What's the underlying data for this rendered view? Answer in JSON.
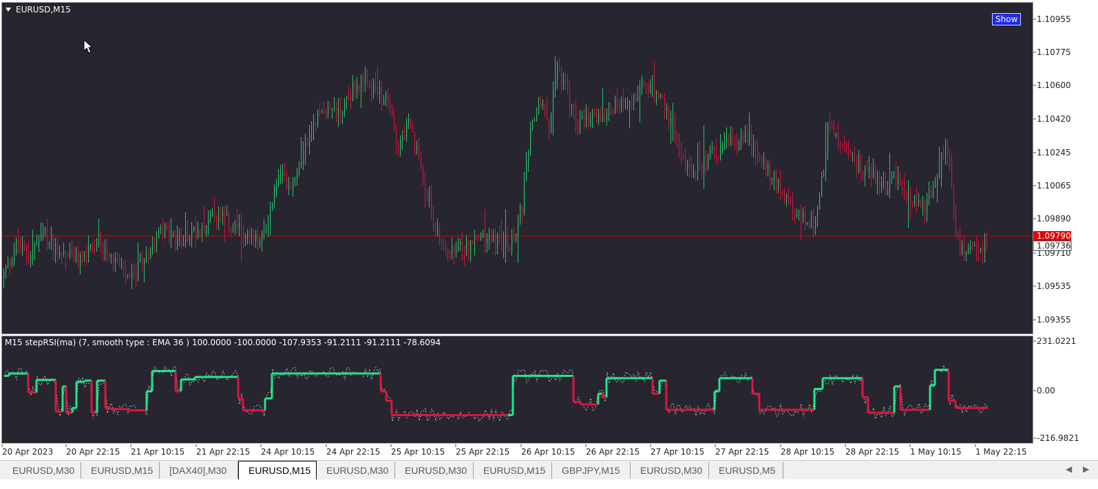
{
  "chart": {
    "symbol_title": "EURUSD,M15",
    "show_button": "Show",
    "price_ticks": [
      "1.10955",
      "1.10775",
      "1.10600",
      "1.10420",
      "1.10245",
      "1.10065",
      "1.09890",
      "1.09710",
      "1.09535",
      "1.09355"
    ],
    "price_line_label": "1.09790",
    "bid_label": "1.09736",
    "time_labels": [
      "20 Apr 2023",
      "20 Apr 22:15",
      "21 Apr 10:15",
      "21 Apr 22:15",
      "24 Apr 10:15",
      "24 Apr 22:15",
      "25 Apr 10:15",
      "25 Apr 22:15",
      "26 Apr 10:15",
      "26 Apr 22:15",
      "27 Apr 10:15",
      "27 Apr 22:15",
      "28 Apr 10:15",
      "28 Apr 22:15",
      "1 May 10:15",
      "1 May 22:15"
    ],
    "colors": {
      "background": "#272530",
      "bull": "#27c46b",
      "bear": "#d0143c",
      "price_line": "#d40000"
    }
  },
  "indicator": {
    "title": "M15 stepRSI(ma)  (7, smooth type : EMA  36 ) 100.0000 -100.0000 -107.9353 -91.2111 -91.2111 -78.6094",
    "ticks": [
      "231.0221",
      "0.00",
      "-216.9821"
    ],
    "colors": {
      "up": "#1ee88a",
      "down": "#e0143c",
      "raw": "#d8d8d8"
    }
  },
  "tabs": [
    {
      "label": "EURUSD,M30",
      "active": false
    },
    {
      "label": "EURUSD,M15",
      "active": false
    },
    {
      "label": "[DAX40],M30",
      "active": false
    },
    {
      "label": "EURUSD,M15",
      "active": true
    },
    {
      "label": "EURUSD,M30",
      "active": false
    },
    {
      "label": "EURUSD,M30",
      "active": false
    },
    {
      "label": "EURUSD,M15",
      "active": false
    },
    {
      "label": "GBPJPY,M15",
      "active": false
    },
    {
      "label": "EURUSD,M30",
      "active": false
    },
    {
      "label": "EURUSD,M5",
      "active": false
    }
  ],
  "chart_data": {
    "type": "candlestick",
    "title": "EURUSD,M15",
    "x_range": [
      "20 Apr 2023",
      "1 May 22:15"
    ],
    "ylim": [
      1.0925,
      1.1108
    ],
    "price_line": 1.0979,
    "bid": 1.09736,
    "close_path": [
      [
        "20 Apr 2023",
        1.0962
      ],
      [
        "20 Apr 22:15",
        1.0968
      ],
      [
        "21 Apr 10:15",
        1.0968
      ],
      [
        "21 Apr 22:15",
        1.0983
      ],
      [
        "24 Apr 10:15",
        1.1015
      ],
      [
        "24 Apr 22:15",
        1.106
      ],
      [
        "25 Apr 10:15",
        1.0978
      ],
      [
        "25 Apr 22:15",
        1.0972
      ],
      [
        "26 Apr 10:15",
        1.105
      ],
      [
        "26 Apr 22:15",
        1.104
      ],
      [
        "27 Apr 10:15",
        1.1018
      ],
      [
        "27 Apr 22:15",
        1.1028
      ],
      [
        "28 Apr 10:15",
        1.099
      ],
      [
        "28 Apr 22:15",
        1.1005
      ],
      [
        "1 May 10:15",
        1.101
      ],
      [
        "1 May 22:15",
        1.0972
      ]
    ],
    "indicator": {
      "name": "stepRSI(ma)",
      "ylim": [
        -216.9821,
        231.0221
      ],
      "levels": [
        100,
        -100
      ]
    }
  }
}
